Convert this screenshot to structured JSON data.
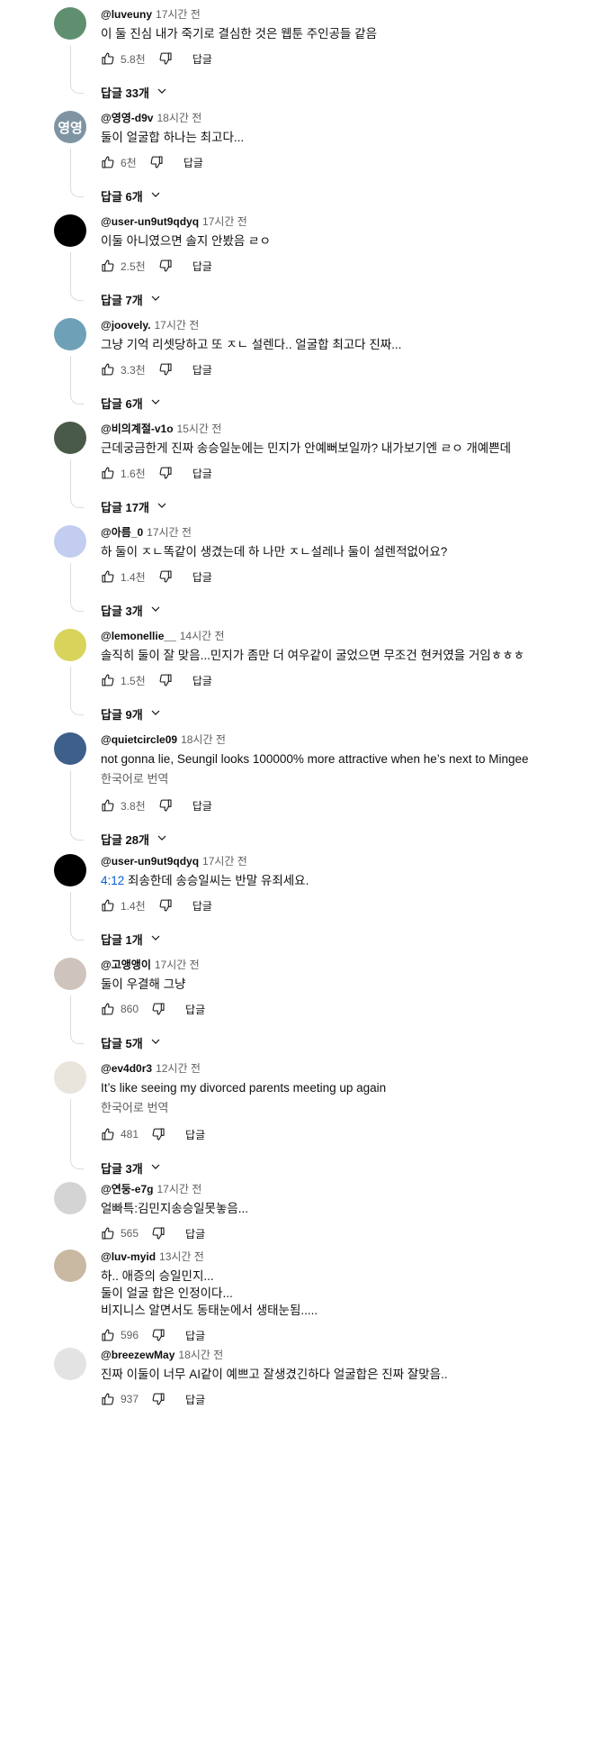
{
  "reply_label": "답글",
  "comments": [
    {
      "author": "@luveuny",
      "time": "17시간 전",
      "text": "이 둘 진심 내가 죽기로 결심한 것은 웹툰 주인공들 같음",
      "likes": "5.8천",
      "replies": "답글 33개",
      "avatar_color": "#5f8f6f"
    },
    {
      "author": "@영영-d9v",
      "time": "18시간 전",
      "text": "둘이 얼굴합 하나는 최고다...",
      "likes": "6천",
      "replies": "답글 6개",
      "avatar_color": "#7f94a3",
      "avatar_text": "영영"
    },
    {
      "author": "@user-un9ut9qdyq",
      "time": "17시간 전",
      "text": "이둘 아니였으면 솔지 안봤음 ㄹㅇ",
      "likes": "2.5천",
      "replies": "답글 7개",
      "avatar_color": "#000000"
    },
    {
      "author": "@joovely.",
      "time": "17시간 전",
      "text": "그냥 기억 리셋당하고 또 ㅈㄴ 설렌다.. 얼굴합 최고다 진짜...",
      "likes": "3.3천",
      "replies": "답글 6개",
      "avatar_color": "#6ea0b8"
    },
    {
      "author": "@비의계절-v1o",
      "time": "15시간 전",
      "text": "근데궁금한게 진짜 송승일눈에는 민지가 안예뻐보일까? 내가보기엔 ㄹㅇ 개예쁜데",
      "likes": "1.6천",
      "replies": "답글 17개",
      "avatar_color": "#4a5a4a"
    },
    {
      "author": "@아름_0",
      "time": "17시간 전",
      "text": "하 둘이 ㅈㄴ똑같이 생겼는데 하 나만 ㅈㄴ설레나 둘이 설렌적없어요?",
      "likes": "1.4천",
      "replies": "답글 3개",
      "avatar_color": "#c3cdf0"
    },
    {
      "author": "@lemonellie__",
      "time": "14시간 전",
      "text": "솔직히 둘이 잘 맞음...민지가 좀만 더 여우같이 굴었으면 무조건 현커였을 거임ㅎㅎㅎ",
      "likes": "1.5천",
      "replies": "답글 9개",
      "avatar_color": "#d8d35a"
    },
    {
      "author": "@quietcircle09",
      "time": "18시간 전",
      "text": "not gonna lie, Seungil looks 100000% more attractive when he’s next to Mingee",
      "translate": "한국어로 번역",
      "likes": "3.8천",
      "replies": "답글 28개",
      "avatar_color": "#3e5f8a"
    },
    {
      "author": "@user-un9ut9qdyq",
      "time": "17시간 전",
      "timestamp": "4:12",
      "text": " 죄송한데 송승일씨는 반말 유죄세요.",
      "likes": "1.4천",
      "replies": "답글 1개",
      "avatar_color": "#000000"
    },
    {
      "author": "@고앵앵이",
      "time": "17시간 전",
      "text": "둘이 우결해 그냥",
      "likes": "860",
      "replies": "답글 5개",
      "avatar_color": "#cfc4bd"
    },
    {
      "author": "@ev4d0r3",
      "time": "12시간 전",
      "text": "It’s like seeing my divorced parents meeting up again",
      "translate": "한국어로 번역",
      "likes": "481",
      "replies": "답글 3개",
      "avatar_color": "#e9e4dc"
    },
    {
      "author": "@연둥-e7g",
      "time": "17시간 전",
      "text": "얼빠특:김민지송승일못놓음...",
      "likes": "565",
      "avatar_color": "#d4d4d4"
    },
    {
      "author": "@luv-myid",
      "time": "13시간 전",
      "text": "하.. 애증의 승일민지...\n둘이 얼굴 합은 인정이다...\n비지니스 알면서도 동태눈에서 생태눈됨.....",
      "likes": "596",
      "avatar_color": "#c9b8a2"
    },
    {
      "author": "@breezewMay",
      "time": "18시간 전",
      "text": "진짜 이둘이 너무 AI같이 예쁘고 잘생겼긴하다 얼굴합은 진짜 잘맞음..",
      "likes": "937",
      "avatar_color": "#e3e3e3"
    }
  ]
}
